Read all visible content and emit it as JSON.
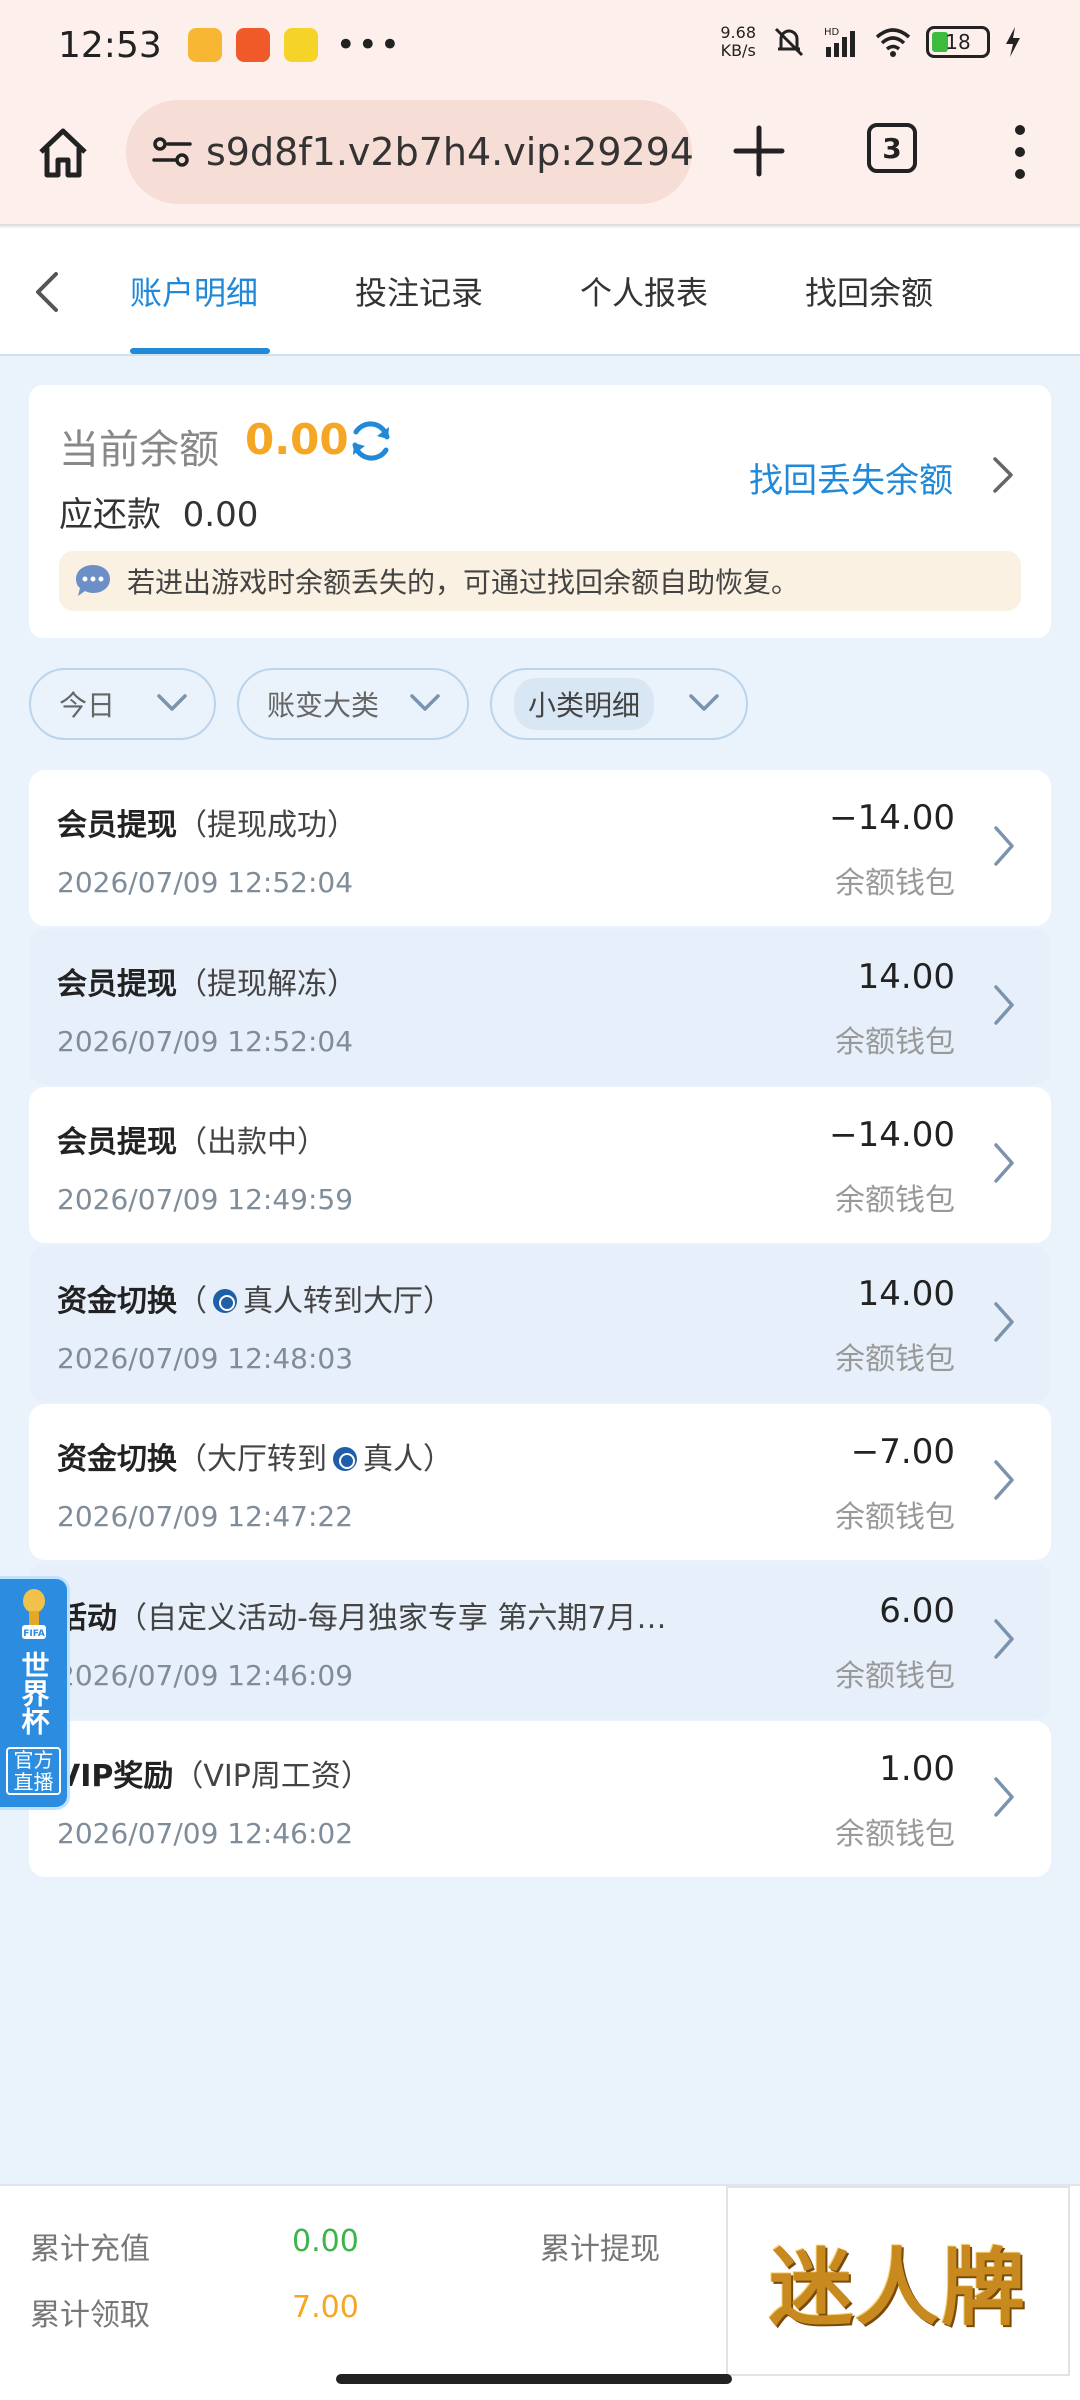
{
  "status_bar": {
    "time": "12:53",
    "net_speed_value": "9.68",
    "net_speed_unit": "KB/s",
    "network_label": "HD",
    "battery": "18"
  },
  "browser": {
    "url": "s9d8f1.v2b7h4.vip:29294",
    "tab_count": "3"
  },
  "tabs": [
    {
      "label": "账户明细",
      "active": true
    },
    {
      "label": "投注记录",
      "active": false
    },
    {
      "label": "个人报表",
      "active": false
    },
    {
      "label": "找回余额",
      "active": false
    }
  ],
  "balance": {
    "label": "当前余额",
    "value": "0.00",
    "owe_label": "应还款",
    "owe_value": "0.00",
    "recover_link": "找回丢失余额",
    "notice": "若进出游戏时余额丢失的，可通过找回余额自助恢复。"
  },
  "filters": [
    {
      "label": "今日"
    },
    {
      "label": "账变大类"
    },
    {
      "label": "小类明细"
    }
  ],
  "records": [
    {
      "category": "会员提现",
      "sub_prefix": "（提现成功）",
      "sub_suffix": "",
      "time": "2026/07/09 12:52:04",
      "amount": "−14.00",
      "wallet": "余额钱包"
    },
    {
      "category": "会员提现",
      "sub_prefix": "（提现解冻）",
      "sub_suffix": "",
      "time": "2026/07/09 12:52:04",
      "amount": "14.00",
      "wallet": "余额钱包"
    },
    {
      "category": "会员提现",
      "sub_prefix": "（出款中）",
      "sub_suffix": "",
      "time": "2026/07/09 12:49:59",
      "amount": "−14.00",
      "wallet": "余额钱包"
    },
    {
      "category": "资金切换",
      "sub_prefix": "（",
      "sub_suffix": "真人转到大厅）",
      "time": "2026/07/09 12:48:03",
      "amount": "14.00",
      "wallet": "余额钱包"
    },
    {
      "category": "资金切换",
      "sub_prefix": "（大厅转到",
      "sub_suffix": "真人）",
      "time": "2026/07/09 12:47:22",
      "amount": "−7.00",
      "wallet": "余额钱包"
    },
    {
      "category": "活动",
      "sub_prefix": "（自定义活动-每月独家专享 第六期7月…",
      "sub_suffix": "",
      "time": "2026/07/09 12:46:09",
      "amount": "6.00",
      "wallet": "余额钱包"
    },
    {
      "category": "VIP奖励",
      "sub_prefix": "（VIP周工资）",
      "sub_suffix": "",
      "time": "2026/07/09 12:46:02",
      "amount": "1.00",
      "wallet": "余额钱包"
    }
  ],
  "world_cup_badge": {
    "title": "世界杯",
    "subtitle": "官方直播",
    "cup_text": "FIFA"
  },
  "footer": {
    "recharge_label": "累计充值",
    "recharge_value": "0.00",
    "withdraw_label": "累计提现",
    "claim_label": "累计领取",
    "claim_value": "7.00",
    "brand": "迷人牌"
  },
  "colors": {
    "accent_blue": "#2189d8",
    "balance_orange": "#f5a623",
    "positive_green": "#3bb54a",
    "page_bg": "#eaf2fb"
  }
}
